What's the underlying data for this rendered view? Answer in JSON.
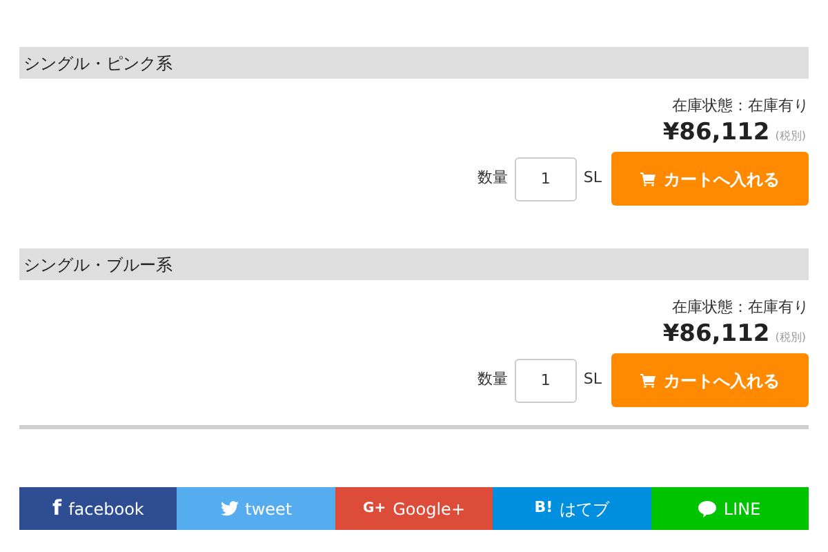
{
  "products": [
    {
      "title": "シングル・ピンク系",
      "stock": "在庫状態：在庫有り",
      "price": "¥86,112",
      "tax_note": "(税別)",
      "quantity_label": "数量",
      "quantity": "1",
      "unit": "SL",
      "cart_button": "カートへ入れる"
    },
    {
      "title": "シングル・ブルー系",
      "stock": "在庫状態：在庫有り",
      "price": "¥86,112",
      "tax_note": "(税別)",
      "quantity_label": "数量",
      "quantity": "1",
      "unit": "SL",
      "cart_button": "カートへ入れる"
    }
  ],
  "share_buttons": [
    {
      "kind": "facebook",
      "glyph": "f",
      "label": "facebook",
      "color": "#2e4d93"
    },
    {
      "kind": "twitter",
      "label": "tweet",
      "color": "#55acee"
    },
    {
      "kind": "google",
      "glyph": "G+",
      "label": "Google+",
      "color": "#dd4b39"
    },
    {
      "kind": "hatena",
      "glyph": "B!",
      "label": "はてブ",
      "color": "#008fde"
    },
    {
      "kind": "line",
      "label": "LINE",
      "color": "#00c300"
    }
  ]
}
